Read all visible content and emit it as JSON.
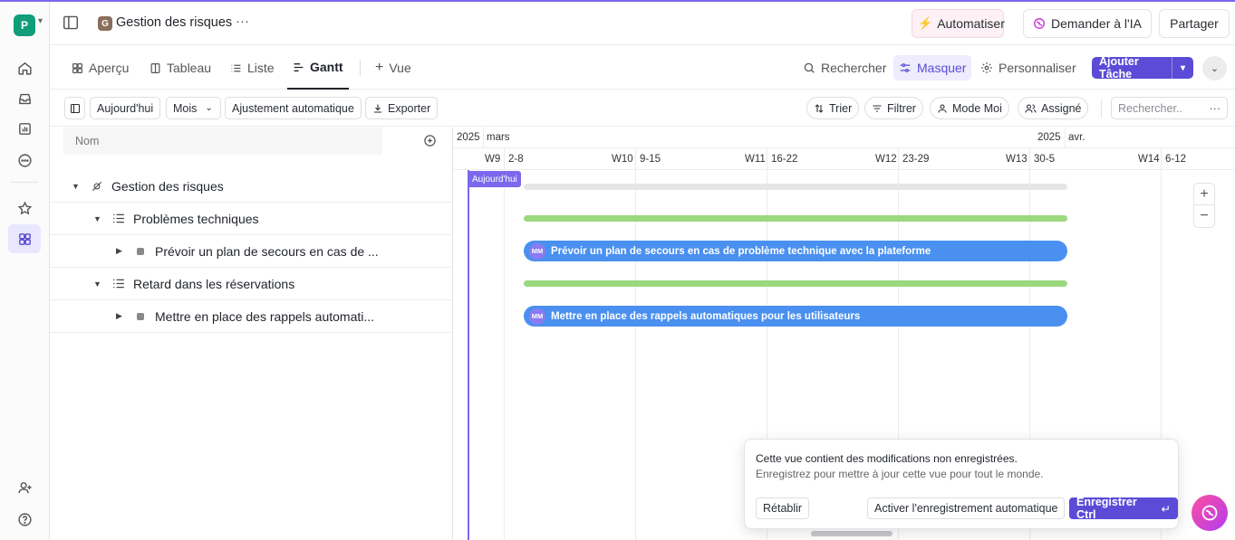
{
  "workspace": {
    "initial": "P"
  },
  "header": {
    "space_initial": "G",
    "title": "Gestion des risques",
    "more": "···",
    "automate_label": "Automatiser",
    "ask_ai_label": "Demander à l'IA",
    "share_label": "Partager"
  },
  "tabs": [
    {
      "label": "Aperçu",
      "icon": "grid-icon"
    },
    {
      "label": "Tableau",
      "icon": "board-icon"
    },
    {
      "label": "Liste",
      "icon": "list-icon"
    },
    {
      "label": "Gantt",
      "icon": "gantt-icon",
      "active": true
    }
  ],
  "add_view_label": "Vue",
  "tab_actions": {
    "search_label": "Rechercher",
    "hide_label": "Masquer",
    "customize_label": "Personnaliser",
    "add_task_label": "Ajouter Tâche"
  },
  "toolbar": {
    "today_label": "Aujourd'hui",
    "scale_label": "Mois",
    "autofit_label": "Ajustement automatique",
    "export_label": "Exporter",
    "sort_label": "Trier",
    "filter_label": "Filtrer",
    "me_mode_label": "Mode Moi",
    "assigned_label": "Assigné",
    "search_placeholder": "Rechercher..",
    "more": "···"
  },
  "tree": {
    "column_header": "Nom",
    "rows": [
      {
        "label": "Gestion des risques",
        "level": 0
      },
      {
        "label": "Problèmes techniques",
        "level": 1
      },
      {
        "label": "Prévoir un plan de secours en cas de ...",
        "level": 2
      },
      {
        "label": "Retard dans les réservations",
        "level": 1
      },
      {
        "label": "Mettre en place des rappels automati...",
        "level": 2
      }
    ]
  },
  "gantt": {
    "year_left": "2025",
    "month_left": "mars",
    "year_right": "2025",
    "month_right": "avr.",
    "weeks": [
      {
        "label": "W9",
        "range": "2-8"
      },
      {
        "label": "W10",
        "range": "9-15"
      },
      {
        "label": "W11",
        "range": "16-22"
      },
      {
        "label": "W12",
        "range": "23-29"
      },
      {
        "label": "W13",
        "range": "30-5"
      },
      {
        "label": "W14",
        "range": "6-12"
      }
    ],
    "today_label": "Aujourd'hui",
    "tasks": [
      {
        "assignee": "MM",
        "label": "Prévoir un plan de secours en cas de problème technique avec la plateforme"
      },
      {
        "assignee": "MM",
        "label": "Mettre en place des rappels automatiques pour les utilisateurs"
      }
    ],
    "zoom_in": "+",
    "zoom_out": "−"
  },
  "toast": {
    "title": "Cette vue contient des modifications non enregistrées.",
    "subtitle": "Enregistrez pour mettre à jour cette vue pour tout le monde.",
    "reset_label": "Rétablir",
    "autosave_label": "Activer l'enregistrement automatique",
    "save_label": "Enregistrer Ctrl"
  },
  "colors": {
    "accent": "#7b68ee",
    "add_task_button": "#5b4bd6",
    "bar_blue": "#4a90f0",
    "bar_green": "#9bd87e",
    "workspace": "#0f9d7a"
  }
}
